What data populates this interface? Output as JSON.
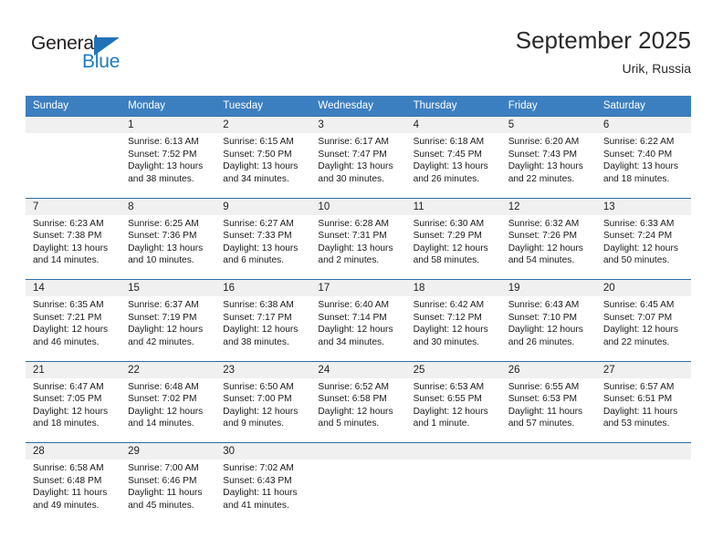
{
  "logo": {
    "text_dark": "General",
    "text_blue": "Blue",
    "icon": "triangle-icon",
    "colors": {
      "dark": "#231f20",
      "blue": "#1f7ac4",
      "triangle": "#1f72b8"
    }
  },
  "header": {
    "title": "September 2025",
    "subtitle": "Urik, Russia"
  },
  "colors": {
    "header_bg": "#3c7fc1",
    "header_text": "#ffffff",
    "row_separator": "#2e6da4",
    "daynum_bg": "#f0f0f0",
    "cell_bg": "#ffffff",
    "text": "#1a1a1a"
  },
  "weekdays": [
    "Sunday",
    "Monday",
    "Tuesday",
    "Wednesday",
    "Thursday",
    "Friday",
    "Saturday"
  ],
  "labels": {
    "sunrise": "Sunrise:",
    "sunset": "Sunset:",
    "daylight": "Daylight:"
  },
  "weeks": [
    {
      "days": [
        {
          "num": "",
          "sunrise": "",
          "sunset": "",
          "daylight1": "",
          "daylight2": ""
        },
        {
          "num": "1",
          "sunrise": "Sunrise: 6:13 AM",
          "sunset": "Sunset: 7:52 PM",
          "daylight1": "Daylight: 13 hours",
          "daylight2": "and 38 minutes."
        },
        {
          "num": "2",
          "sunrise": "Sunrise: 6:15 AM",
          "sunset": "Sunset: 7:50 PM",
          "daylight1": "Daylight: 13 hours",
          "daylight2": "and 34 minutes."
        },
        {
          "num": "3",
          "sunrise": "Sunrise: 6:17 AM",
          "sunset": "Sunset: 7:47 PM",
          "daylight1": "Daylight: 13 hours",
          "daylight2": "and 30 minutes."
        },
        {
          "num": "4",
          "sunrise": "Sunrise: 6:18 AM",
          "sunset": "Sunset: 7:45 PM",
          "daylight1": "Daylight: 13 hours",
          "daylight2": "and 26 minutes."
        },
        {
          "num": "5",
          "sunrise": "Sunrise: 6:20 AM",
          "sunset": "Sunset: 7:43 PM",
          "daylight1": "Daylight: 13 hours",
          "daylight2": "and 22 minutes."
        },
        {
          "num": "6",
          "sunrise": "Sunrise: 6:22 AM",
          "sunset": "Sunset: 7:40 PM",
          "daylight1": "Daylight: 13 hours",
          "daylight2": "and 18 minutes."
        }
      ]
    },
    {
      "days": [
        {
          "num": "7",
          "sunrise": "Sunrise: 6:23 AM",
          "sunset": "Sunset: 7:38 PM",
          "daylight1": "Daylight: 13 hours",
          "daylight2": "and 14 minutes."
        },
        {
          "num": "8",
          "sunrise": "Sunrise: 6:25 AM",
          "sunset": "Sunset: 7:36 PM",
          "daylight1": "Daylight: 13 hours",
          "daylight2": "and 10 minutes."
        },
        {
          "num": "9",
          "sunrise": "Sunrise: 6:27 AM",
          "sunset": "Sunset: 7:33 PM",
          "daylight1": "Daylight: 13 hours",
          "daylight2": "and 6 minutes."
        },
        {
          "num": "10",
          "sunrise": "Sunrise: 6:28 AM",
          "sunset": "Sunset: 7:31 PM",
          "daylight1": "Daylight: 13 hours",
          "daylight2": "and 2 minutes."
        },
        {
          "num": "11",
          "sunrise": "Sunrise: 6:30 AM",
          "sunset": "Sunset: 7:29 PM",
          "daylight1": "Daylight: 12 hours",
          "daylight2": "and 58 minutes."
        },
        {
          "num": "12",
          "sunrise": "Sunrise: 6:32 AM",
          "sunset": "Sunset: 7:26 PM",
          "daylight1": "Daylight: 12 hours",
          "daylight2": "and 54 minutes."
        },
        {
          "num": "13",
          "sunrise": "Sunrise: 6:33 AM",
          "sunset": "Sunset: 7:24 PM",
          "daylight1": "Daylight: 12 hours",
          "daylight2": "and 50 minutes."
        }
      ]
    },
    {
      "days": [
        {
          "num": "14",
          "sunrise": "Sunrise: 6:35 AM",
          "sunset": "Sunset: 7:21 PM",
          "daylight1": "Daylight: 12 hours",
          "daylight2": "and 46 minutes."
        },
        {
          "num": "15",
          "sunrise": "Sunrise: 6:37 AM",
          "sunset": "Sunset: 7:19 PM",
          "daylight1": "Daylight: 12 hours",
          "daylight2": "and 42 minutes."
        },
        {
          "num": "16",
          "sunrise": "Sunrise: 6:38 AM",
          "sunset": "Sunset: 7:17 PM",
          "daylight1": "Daylight: 12 hours",
          "daylight2": "and 38 minutes."
        },
        {
          "num": "17",
          "sunrise": "Sunrise: 6:40 AM",
          "sunset": "Sunset: 7:14 PM",
          "daylight1": "Daylight: 12 hours",
          "daylight2": "and 34 minutes."
        },
        {
          "num": "18",
          "sunrise": "Sunrise: 6:42 AM",
          "sunset": "Sunset: 7:12 PM",
          "daylight1": "Daylight: 12 hours",
          "daylight2": "and 30 minutes."
        },
        {
          "num": "19",
          "sunrise": "Sunrise: 6:43 AM",
          "sunset": "Sunset: 7:10 PM",
          "daylight1": "Daylight: 12 hours",
          "daylight2": "and 26 minutes."
        },
        {
          "num": "20",
          "sunrise": "Sunrise: 6:45 AM",
          "sunset": "Sunset: 7:07 PM",
          "daylight1": "Daylight: 12 hours",
          "daylight2": "and 22 minutes."
        }
      ]
    },
    {
      "days": [
        {
          "num": "21",
          "sunrise": "Sunrise: 6:47 AM",
          "sunset": "Sunset: 7:05 PM",
          "daylight1": "Daylight: 12 hours",
          "daylight2": "and 18 minutes."
        },
        {
          "num": "22",
          "sunrise": "Sunrise: 6:48 AM",
          "sunset": "Sunset: 7:02 PM",
          "daylight1": "Daylight: 12 hours",
          "daylight2": "and 14 minutes."
        },
        {
          "num": "23",
          "sunrise": "Sunrise: 6:50 AM",
          "sunset": "Sunset: 7:00 PM",
          "daylight1": "Daylight: 12 hours",
          "daylight2": "and 9 minutes."
        },
        {
          "num": "24",
          "sunrise": "Sunrise: 6:52 AM",
          "sunset": "Sunset: 6:58 PM",
          "daylight1": "Daylight: 12 hours",
          "daylight2": "and 5 minutes."
        },
        {
          "num": "25",
          "sunrise": "Sunrise: 6:53 AM",
          "sunset": "Sunset: 6:55 PM",
          "daylight1": "Daylight: 12 hours",
          "daylight2": "and 1 minute."
        },
        {
          "num": "26",
          "sunrise": "Sunrise: 6:55 AM",
          "sunset": "Sunset: 6:53 PM",
          "daylight1": "Daylight: 11 hours",
          "daylight2": "and 57 minutes."
        },
        {
          "num": "27",
          "sunrise": "Sunrise: 6:57 AM",
          "sunset": "Sunset: 6:51 PM",
          "daylight1": "Daylight: 11 hours",
          "daylight2": "and 53 minutes."
        }
      ]
    },
    {
      "days": [
        {
          "num": "28",
          "sunrise": "Sunrise: 6:58 AM",
          "sunset": "Sunset: 6:48 PM",
          "daylight1": "Daylight: 11 hours",
          "daylight2": "and 49 minutes."
        },
        {
          "num": "29",
          "sunrise": "Sunrise: 7:00 AM",
          "sunset": "Sunset: 6:46 PM",
          "daylight1": "Daylight: 11 hours",
          "daylight2": "and 45 minutes."
        },
        {
          "num": "30",
          "sunrise": "Sunrise: 7:02 AM",
          "sunset": "Sunset: 6:43 PM",
          "daylight1": "Daylight: 11 hours",
          "daylight2": "and 41 minutes."
        },
        {
          "num": "",
          "sunrise": "",
          "sunset": "",
          "daylight1": "",
          "daylight2": ""
        },
        {
          "num": "",
          "sunrise": "",
          "sunset": "",
          "daylight1": "",
          "daylight2": ""
        },
        {
          "num": "",
          "sunrise": "",
          "sunset": "",
          "daylight1": "",
          "daylight2": ""
        },
        {
          "num": "",
          "sunrise": "",
          "sunset": "",
          "daylight1": "",
          "daylight2": ""
        }
      ]
    }
  ]
}
